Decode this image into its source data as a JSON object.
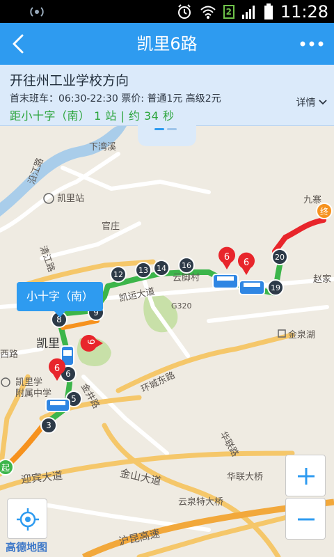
{
  "status_bar": {
    "time": "11:28",
    "sim_label": "2"
  },
  "header": {
    "title": "凯里6路"
  },
  "route_info": {
    "direction": "开往州工业学校方向",
    "times": "首末班车：06:30-22:30   票价: 普通1元 高级2元",
    "distance": "距小十字（南） 1 站 | 约 34 秒",
    "detail_label": "详情"
  },
  "map": {
    "callout_stop": "小十字（南）",
    "start_marker": "起",
    "end_marker": "终",
    "bus_badge": "6",
    "place_labels": {
      "xiawanxi": "下湾溪",
      "yanjianglu": "沿江路",
      "kailizhan": "凯里站",
      "jiujianfang": "九寨",
      "guanzhuang": "官庄",
      "qingjianglu": "清江路",
      "kaiyundadao": "凯运大道",
      "yunchuncun": "云脚村",
      "zhaojia": "赵家",
      "g320": "G320",
      "jinquanhu": "金泉湖",
      "kaili": "凯里",
      "xilu": "西路",
      "kailixue": "凯里学",
      "fushuzhong": "附属中学",
      "jinjinglu": "金井路",
      "huanchengdonglu": "环城东路",
      "hualianlu": "华联路",
      "hualiandaqiao": "华联大桥",
      "yingbindadao": "迎宾大道",
      "jinshandadao": "金山大道",
      "yunquantedaqiao": "云泉特大桥",
      "hukungaosu": "沪昆高速"
    },
    "stops": [
      "3",
      "5",
      "6",
      "8",
      "9",
      "12",
      "13",
      "14",
      "16",
      "19",
      "20"
    ],
    "logo": "高德地图"
  },
  "colors": {
    "header_bg": "#2e9bf0",
    "route_green": "#3cb54a",
    "route_red": "#e8252b",
    "route_orange": "#f6921e",
    "stop_dark": "#2d3a48",
    "bus_blue": "#2f86e3"
  }
}
